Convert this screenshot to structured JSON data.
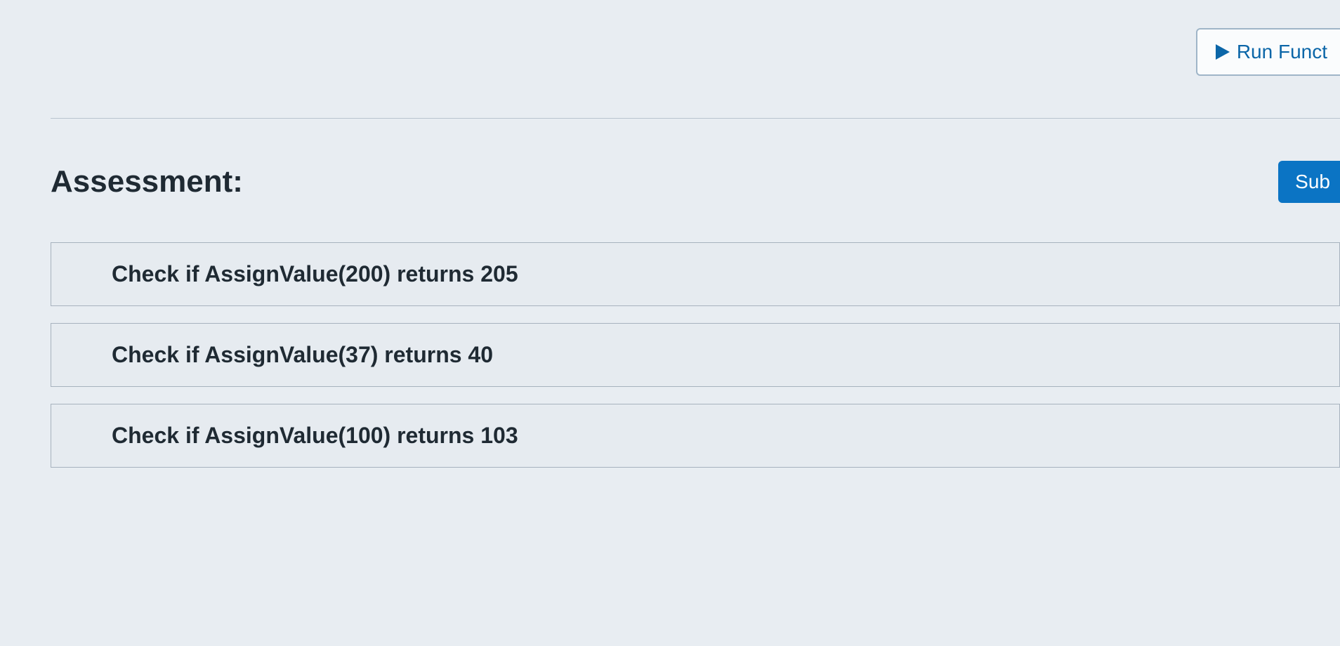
{
  "toolbar": {
    "run_label": "Run Funct"
  },
  "section": {
    "title": "Assessment:",
    "submit_label": "Sub"
  },
  "tests": [
    {
      "text": "Check if AssignValue(200) returns 205"
    },
    {
      "text": "Check if AssignValue(37) returns 40"
    },
    {
      "text": "Check if AssignValue(100) returns 103"
    }
  ]
}
